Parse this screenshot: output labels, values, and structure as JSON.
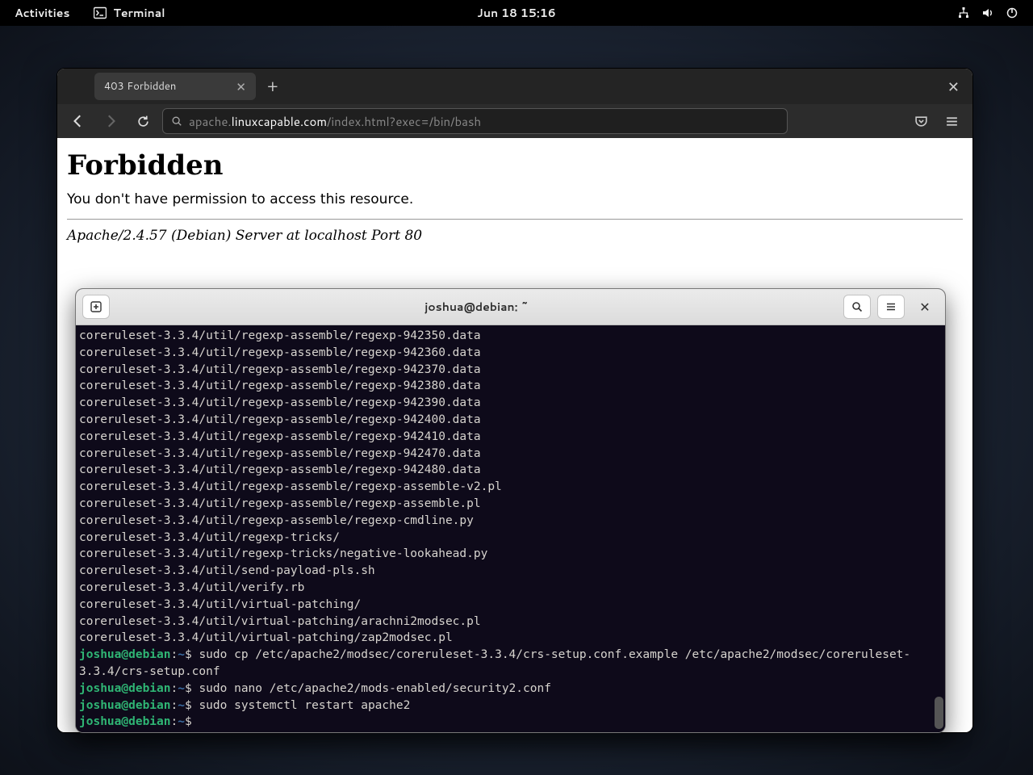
{
  "topbar": {
    "activities": "Activities",
    "app_name": "Terminal",
    "clock": "Jun 18  15:16"
  },
  "browser": {
    "tab_title": "403 Forbidden",
    "url_prefix": "apache.",
    "url_host": "linuxcapable.com",
    "url_path": "/index.html?exec=/bin/bash",
    "page": {
      "heading": "Forbidden",
      "message": "You don't have permission to access this resource.",
      "signature": "Apache/2.4.57 (Debian) Server at localhost Port 80"
    }
  },
  "terminal": {
    "title": "joshua@debian: ~",
    "user": "joshua@debian",
    "sep": ":",
    "cwd": "~",
    "prompt": "$ ",
    "output": [
      "coreruleset-3.3.4/util/regexp-assemble/regexp-942350.data",
      "coreruleset-3.3.4/util/regexp-assemble/regexp-942360.data",
      "coreruleset-3.3.4/util/regexp-assemble/regexp-942370.data",
      "coreruleset-3.3.4/util/regexp-assemble/regexp-942380.data",
      "coreruleset-3.3.4/util/regexp-assemble/regexp-942390.data",
      "coreruleset-3.3.4/util/regexp-assemble/regexp-942400.data",
      "coreruleset-3.3.4/util/regexp-assemble/regexp-942410.data",
      "coreruleset-3.3.4/util/regexp-assemble/regexp-942470.data",
      "coreruleset-3.3.4/util/regexp-assemble/regexp-942480.data",
      "coreruleset-3.3.4/util/regexp-assemble/regexp-assemble-v2.pl",
      "coreruleset-3.3.4/util/regexp-assemble/regexp-assemble.pl",
      "coreruleset-3.3.4/util/regexp-assemble/regexp-cmdline.py",
      "coreruleset-3.3.4/util/regexp-tricks/",
      "coreruleset-3.3.4/util/regexp-tricks/negative-lookahead.py",
      "coreruleset-3.3.4/util/send-payload-pls.sh",
      "coreruleset-3.3.4/util/verify.rb",
      "coreruleset-3.3.4/util/virtual-patching/",
      "coreruleset-3.3.4/util/virtual-patching/arachni2modsec.pl",
      "coreruleset-3.3.4/util/virtual-patching/zap2modsec.pl"
    ],
    "commands": [
      "sudo cp /etc/apache2/modsec/coreruleset-3.3.4/crs-setup.conf.example /etc/apache2/modsec/coreruleset-3.3.4/crs-setup.conf",
      "sudo nano /etc/apache2/mods-enabled/security2.conf",
      "sudo systemctl restart apache2",
      ""
    ]
  }
}
